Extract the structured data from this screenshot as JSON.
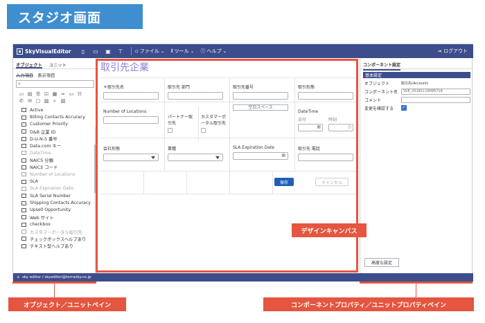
{
  "banner": {
    "title": "スタジオ画面"
  },
  "topbar": {
    "brand": "SkyVisualEditor",
    "menus": [
      "ファイル",
      "ツール",
      "ヘルプ"
    ],
    "logout": "ログアウト"
  },
  "left_pane": {
    "tabs": [
      "オブジェクト",
      "ユニット"
    ],
    "subtabs": [
      "入力項目",
      "表示項目"
    ],
    "search_placeholder": "",
    "fields": [
      {
        "label": "Active",
        "dim": false
      },
      {
        "label": "Billing Contacts Accuracy",
        "dim": false
      },
      {
        "label": "Customer Priority",
        "dim": false
      },
      {
        "label": "D&B 企業 ID",
        "dim": false
      },
      {
        "label": "D-U-N-S 番号",
        "dim": false
      },
      {
        "label": "Data.com キー",
        "dim": false
      },
      {
        "label": "DateTime",
        "dim": true
      },
      {
        "label": "NAICS 分類",
        "dim": false
      },
      {
        "label": "NAICS コード",
        "dim": false
      },
      {
        "label": "Number of Locations",
        "dim": true
      },
      {
        "label": "SLA",
        "dim": false
      },
      {
        "label": "SLA Expiration Date",
        "dim": true
      },
      {
        "label": "SLA Serial Number",
        "dim": false
      },
      {
        "label": "Shipping Contacts Accuracy",
        "dim": false
      },
      {
        "label": "Upsell Opportunity",
        "dim": false
      },
      {
        "label": "Web サイト",
        "dim": false
      },
      {
        "label": "checkbox",
        "dim": false
      },
      {
        "label": "カスタマーポータル取引先",
        "dim": true
      },
      {
        "label": "チェックボックスヘルプあり",
        "dim": false
      },
      {
        "label": "テキスト型ヘルプあり",
        "dim": false
      }
    ]
  },
  "canvas": {
    "title": "取引先企業",
    "row1": [
      "＊取引先名",
      "取引先 部門",
      "取引先番号",
      "取引形態"
    ],
    "row2": {
      "c1": "Number of Locations",
      "c2": "パートナー取引先",
      "c3": "カスタマーポータル取引先",
      "c4_space": "空白スペース",
      "c5": "DateTime",
      "date_label": "日付",
      "time_label": "時刻"
    },
    "row3": [
      "会社形態",
      "業種",
      "SLA Expiration Date",
      "取引先 電話"
    ],
    "save_button": "保存",
    "cancel_button": "キャンセル"
  },
  "right_pane": {
    "tab": "コンポーネント設定",
    "section": "基本設定",
    "props": [
      {
        "label": "オブジェクト",
        "value": "取引先(Account)"
      },
      {
        "label": "コンポーネント名",
        "value": "SVE_20181118095718"
      },
      {
        "label": "コメント",
        "value": ""
      },
      {
        "label": "変更を確認する",
        "value": "checked"
      }
    ],
    "advanced_button": "高度な設定"
  },
  "statusbar": {
    "user": "sky editor / skyeditor@terrasky.co.jp"
  },
  "callouts": {
    "canvas": "デザインキャンバス",
    "left": "オブジェクト／ユニットペイン",
    "right": "コンポーネントプロパティ／ユニットプロパティペイン"
  },
  "colors": {
    "accent": "#3c4d8c",
    "callout": "#e5553f",
    "banner": "#3e8ed0"
  }
}
